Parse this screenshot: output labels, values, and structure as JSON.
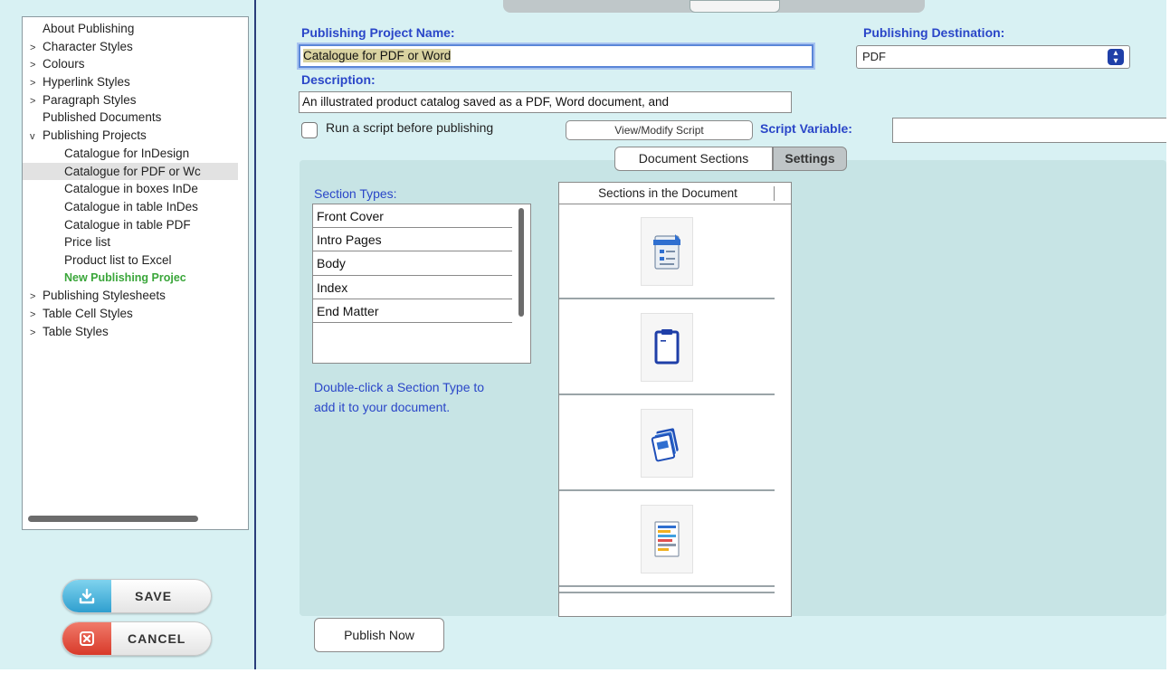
{
  "sidebar": {
    "items": [
      {
        "label": "About Publishing",
        "arrow": ""
      },
      {
        "label": "Character Styles",
        "arrow": ">"
      },
      {
        "label": "Colours",
        "arrow": ">"
      },
      {
        "label": "Hyperlink Styles",
        "arrow": ">"
      },
      {
        "label": "Paragraph Styles",
        "arrow": ">"
      },
      {
        "label": "Published Documents",
        "arrow": ""
      },
      {
        "label": "Publishing Projects",
        "arrow": "v"
      },
      {
        "label": "Catalogue for InDesign",
        "arrow": ""
      },
      {
        "label": "Catalogue for PDF or Wc",
        "arrow": ""
      },
      {
        "label": "Catalogue in boxes InDe",
        "arrow": ""
      },
      {
        "label": "Catalogue in table InDes",
        "arrow": ""
      },
      {
        "label": "Catalogue in table PDF",
        "arrow": ""
      },
      {
        "label": "Price list",
        "arrow": ""
      },
      {
        "label": "Product list to Excel",
        "arrow": ""
      },
      {
        "label": "New Publishing Projec",
        "arrow": ""
      },
      {
        "label": "Publishing Stylesheets",
        "arrow": ">"
      },
      {
        "label": "Table Cell Styles",
        "arrow": ">"
      },
      {
        "label": "Table Styles",
        "arrow": ">"
      }
    ]
  },
  "buttons": {
    "save": "SAVE",
    "cancel": "CANCEL",
    "publish_now": "Publish Now",
    "view_modify_script": "View/Modify Script"
  },
  "form": {
    "project_name_label": "Publishing Project Name:",
    "project_name_value": "Catalogue for PDF or Word",
    "destination_label": "Publishing Destination:",
    "destination_value": "PDF",
    "description_label": "Description:",
    "description_value": "An illustrated product catalog saved as a PDF, Word document, and",
    "run_script_label": "Run a script before publishing",
    "run_script_checked": false,
    "script_variable_label": "Script Variable:",
    "script_variable_value": ""
  },
  "tabs": {
    "document_sections": "Document Sections",
    "settings": "Settings",
    "active": "Document Sections"
  },
  "sections": {
    "types_label": "Section Types:",
    "types": [
      "Front Cover",
      "Intro Pages",
      "Body",
      "Index",
      "End Matter"
    ],
    "help_text": "Double-click a Section Type to add it to your document.",
    "document_header": "Sections in the Document",
    "document_items": [
      "front-cover-icon",
      "clipboard-icon",
      "stacked-pages-icon",
      "index-list-icon"
    ]
  },
  "colors": {
    "background": "#d8f1f3",
    "panel": "#c7e4e5",
    "label_blue": "#2a46c8",
    "new_item_green": "#3aa63a",
    "save_cap": "#2f9fcf",
    "cancel_cap": "#d83a2a"
  }
}
